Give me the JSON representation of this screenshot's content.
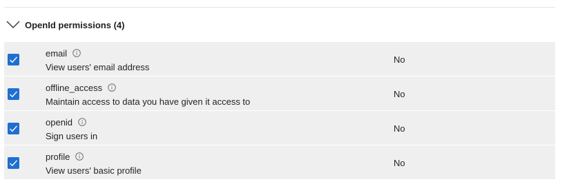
{
  "group": {
    "title": "OpenId permissions (4)",
    "expanded": true,
    "icon": "chevron-down-icon"
  },
  "colors": {
    "checkbox_accent": "#1f6fd0",
    "row_background": "#efefef"
  },
  "permissions": [
    {
      "name": "email",
      "description": "View users' email address",
      "admin_consent": "No",
      "checked": true,
      "info_icon": "info-icon"
    },
    {
      "name": "offline_access",
      "description": "Maintain access to data you have given it access to",
      "admin_consent": "No",
      "checked": true,
      "info_icon": "info-icon"
    },
    {
      "name": "openid",
      "description": "Sign users in",
      "admin_consent": "No",
      "checked": true,
      "info_icon": "info-icon"
    },
    {
      "name": "profile",
      "description": "View users' basic profile",
      "admin_consent": "No",
      "checked": true,
      "info_icon": "info-icon"
    }
  ]
}
